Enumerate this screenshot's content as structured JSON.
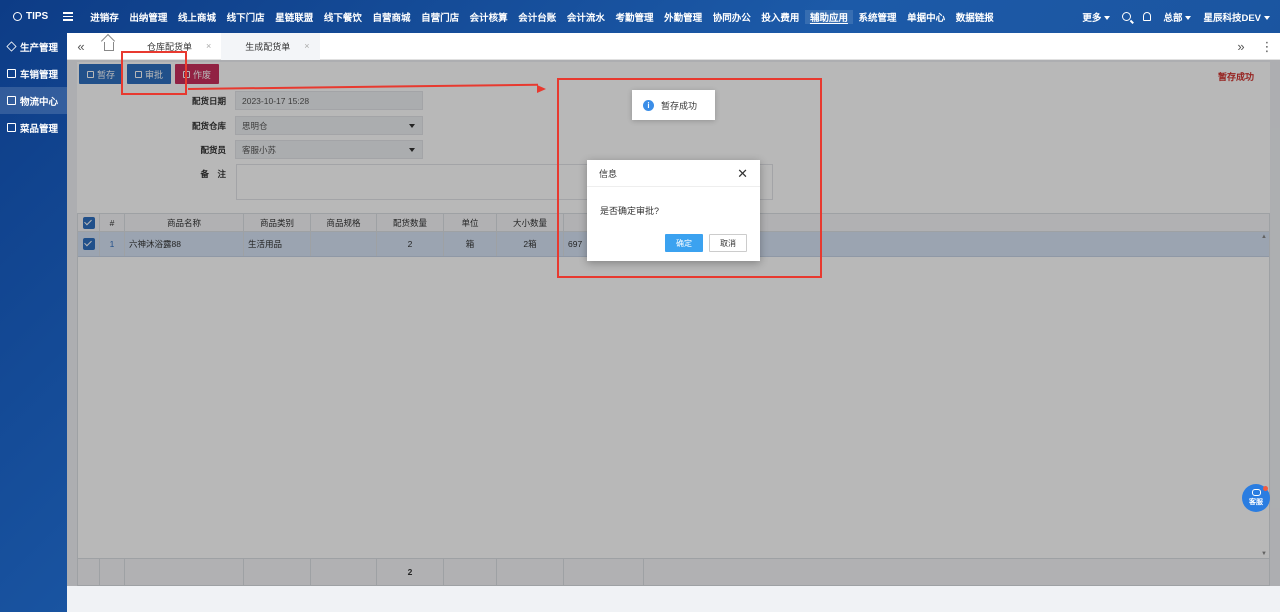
{
  "app": {
    "brand": "TIPS"
  },
  "nav": {
    "items": [
      "进销存",
      "出纳管理",
      "线上商城",
      "线下门店",
      "星链联盟",
      "线下餐饮",
      "自营商城",
      "自营门店",
      "会计核算",
      "会计台账",
      "会计流水",
      "考勤管理",
      "外勤管理",
      "协同办公",
      "投入费用",
      "辅助应用",
      "系统管理",
      "单据中心",
      "数据链报"
    ],
    "active_index": 15,
    "more_label": "更多",
    "org_label": "总部",
    "company_label": "星辰科技DEV"
  },
  "sidebar": {
    "items": [
      {
        "label": "生产管理",
        "icon": "layers-icon"
      },
      {
        "label": "车销管理",
        "icon": "external-link-icon"
      },
      {
        "label": "物流中心",
        "icon": "external-link-icon",
        "active": true
      },
      {
        "label": "菜品管理",
        "icon": "external-link-icon"
      }
    ]
  },
  "tabs": [
    {
      "label": "仓库配货单",
      "close": "×"
    },
    {
      "label": "生成配货单",
      "close": "×",
      "current": true
    }
  ],
  "toolbar": {
    "save_label": "暂存",
    "approve_label": "审批",
    "void_label": "作废"
  },
  "status": {
    "save_message": "暂存成功"
  },
  "form": {
    "date_label": "配货日期",
    "date_value": "2023-10-17 15:28",
    "warehouse_label": "配货仓库",
    "warehouse_value": "思明仓",
    "staff_label": "配货员",
    "staff_value": "客服小苏",
    "remark_label": "备　注"
  },
  "grid": {
    "headers": [
      "#",
      "商品名称",
      "商品类别",
      "商品规格",
      "配货数量",
      "单位",
      "大小数量"
    ],
    "rows": [
      {
        "index": "1",
        "name": "六神沐浴露88",
        "category": "生活用品",
        "spec": "",
        "qty": "2",
        "unit": "箱",
        "size_qty": "2箱",
        "extra": "697"
      }
    ],
    "footer": {
      "qty_total": "2"
    }
  },
  "dialog": {
    "title": "信息",
    "message": "是否确定审批?",
    "ok_label": "确定",
    "cancel_label": "取消",
    "close_glyph": "✕"
  },
  "toast": {
    "icon": "i",
    "message": "暂存成功"
  },
  "help": {
    "label": "客服"
  },
  "colors": {
    "accent": "#2f6fbf",
    "danger": "#c9305d",
    "annotation": "#e8392f",
    "dialog_ok": "#3ba2f0"
  }
}
